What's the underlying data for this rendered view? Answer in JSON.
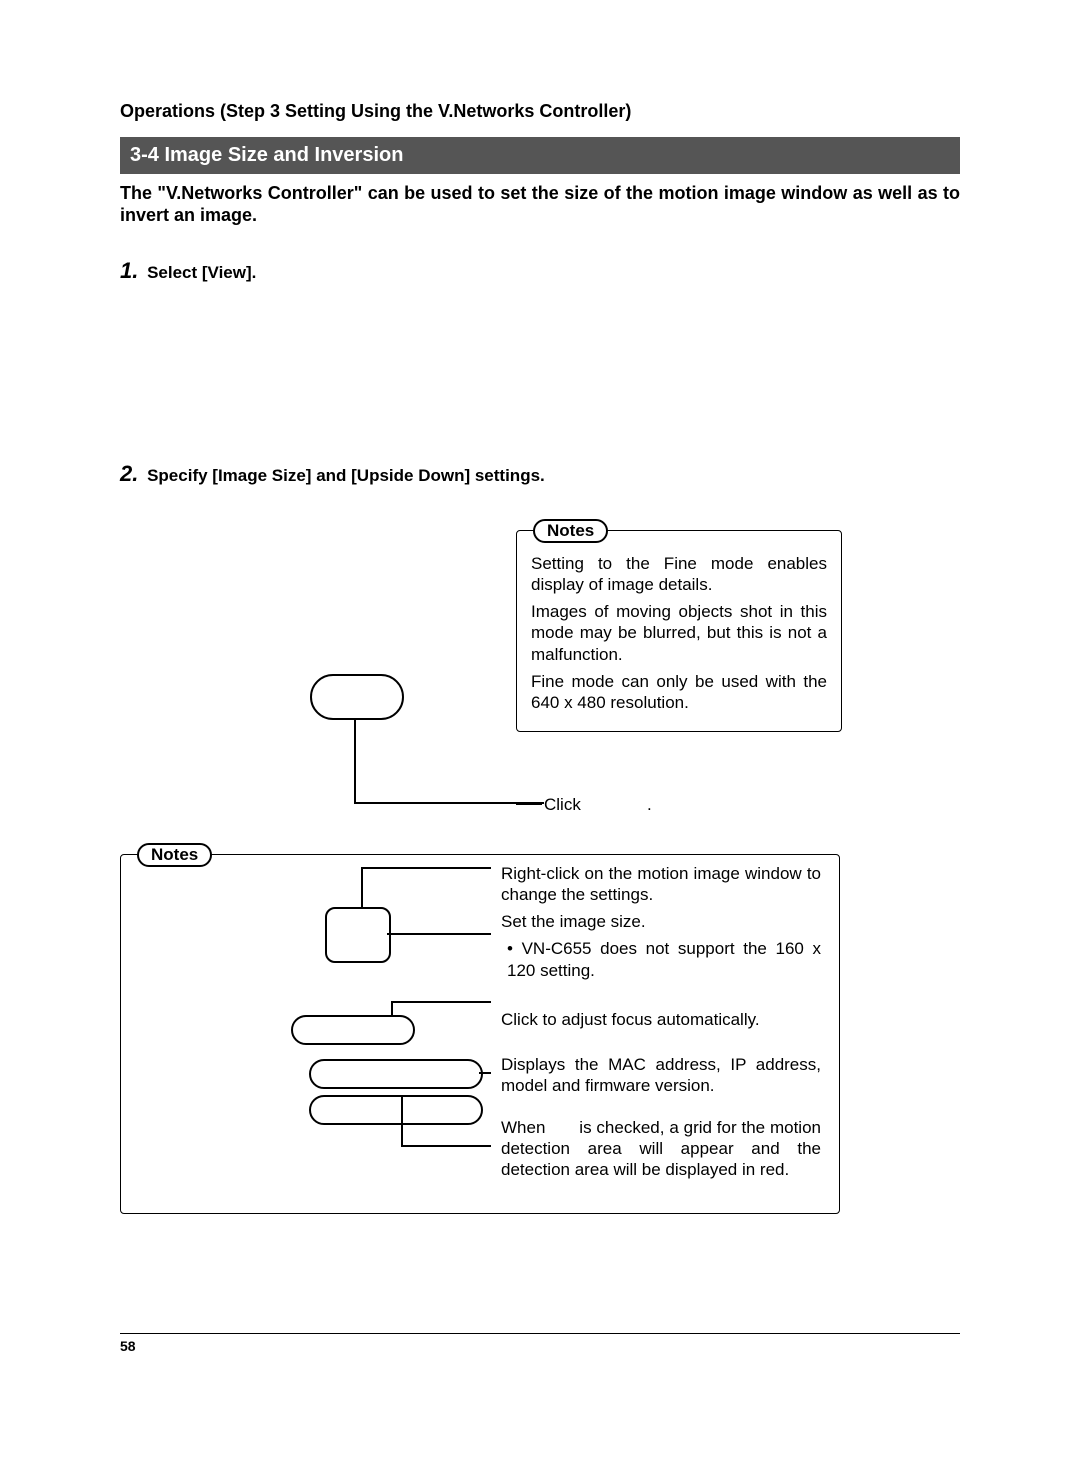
{
  "chapter": "Operations (Step 3 Setting Using the V.Networks Controller)",
  "section_title": "3-4 Image Size and Inversion",
  "intro": "The \"V.Networks Controller\" can be used to set the size of the motion image window as well as to invert an image.",
  "step1_num": "1.",
  "step1_text": " Select [View].",
  "step2_num": "2.",
  "step2_text": " Specify [Image Size] and [Upside Down] settings.",
  "notes_label": "Notes",
  "notes1": {
    "p1": "Setting to the Fine mode enables display of image details.",
    "p2": "Images of moving objects shot in this mode may be blurred, but this is not a malfunction.",
    "p3": "Fine mode can only be used with the 640 x 480 resolution."
  },
  "click_label": "Click              .",
  "notes2": {
    "p1": "Right-click on the motion image window to change the settings.",
    "p2": "Set the image size.",
    "p3_bullet": "• VN-C655 does not support the 160 x 120 setting.",
    "p_focus": "Click to adjust focus automatically.",
    "p_mac": "Displays the MAC address, IP address, model and firmware version.",
    "p_grid": "When       is checked, a grid for the motion detection area will appear and the detection area will be displayed in red."
  },
  "page_number": "58"
}
